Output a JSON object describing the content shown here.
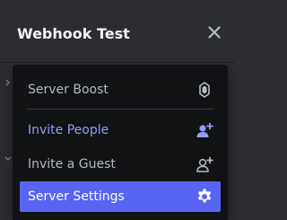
{
  "header": {
    "server_name": "Webhook Test",
    "close_icon": "close-icon"
  },
  "menu": {
    "items": [
      {
        "label": "Server Boost",
        "icon": "boost-gem-icon",
        "color": "#b5bac1"
      },
      {
        "label": "Invite People",
        "icon": "add-person-icon",
        "color": "#949cf7"
      },
      {
        "label": "Invite a Guest",
        "icon": "add-guest-icon",
        "color": "#b5bac1"
      },
      {
        "label": "Server Settings",
        "icon": "gear-icon",
        "color": "#ffffff",
        "highlighted": true
      }
    ]
  },
  "colors": {
    "background": "#2b2d31",
    "menu_background": "#111214",
    "accent": "#5865f2",
    "invite_text": "#949cf7"
  }
}
